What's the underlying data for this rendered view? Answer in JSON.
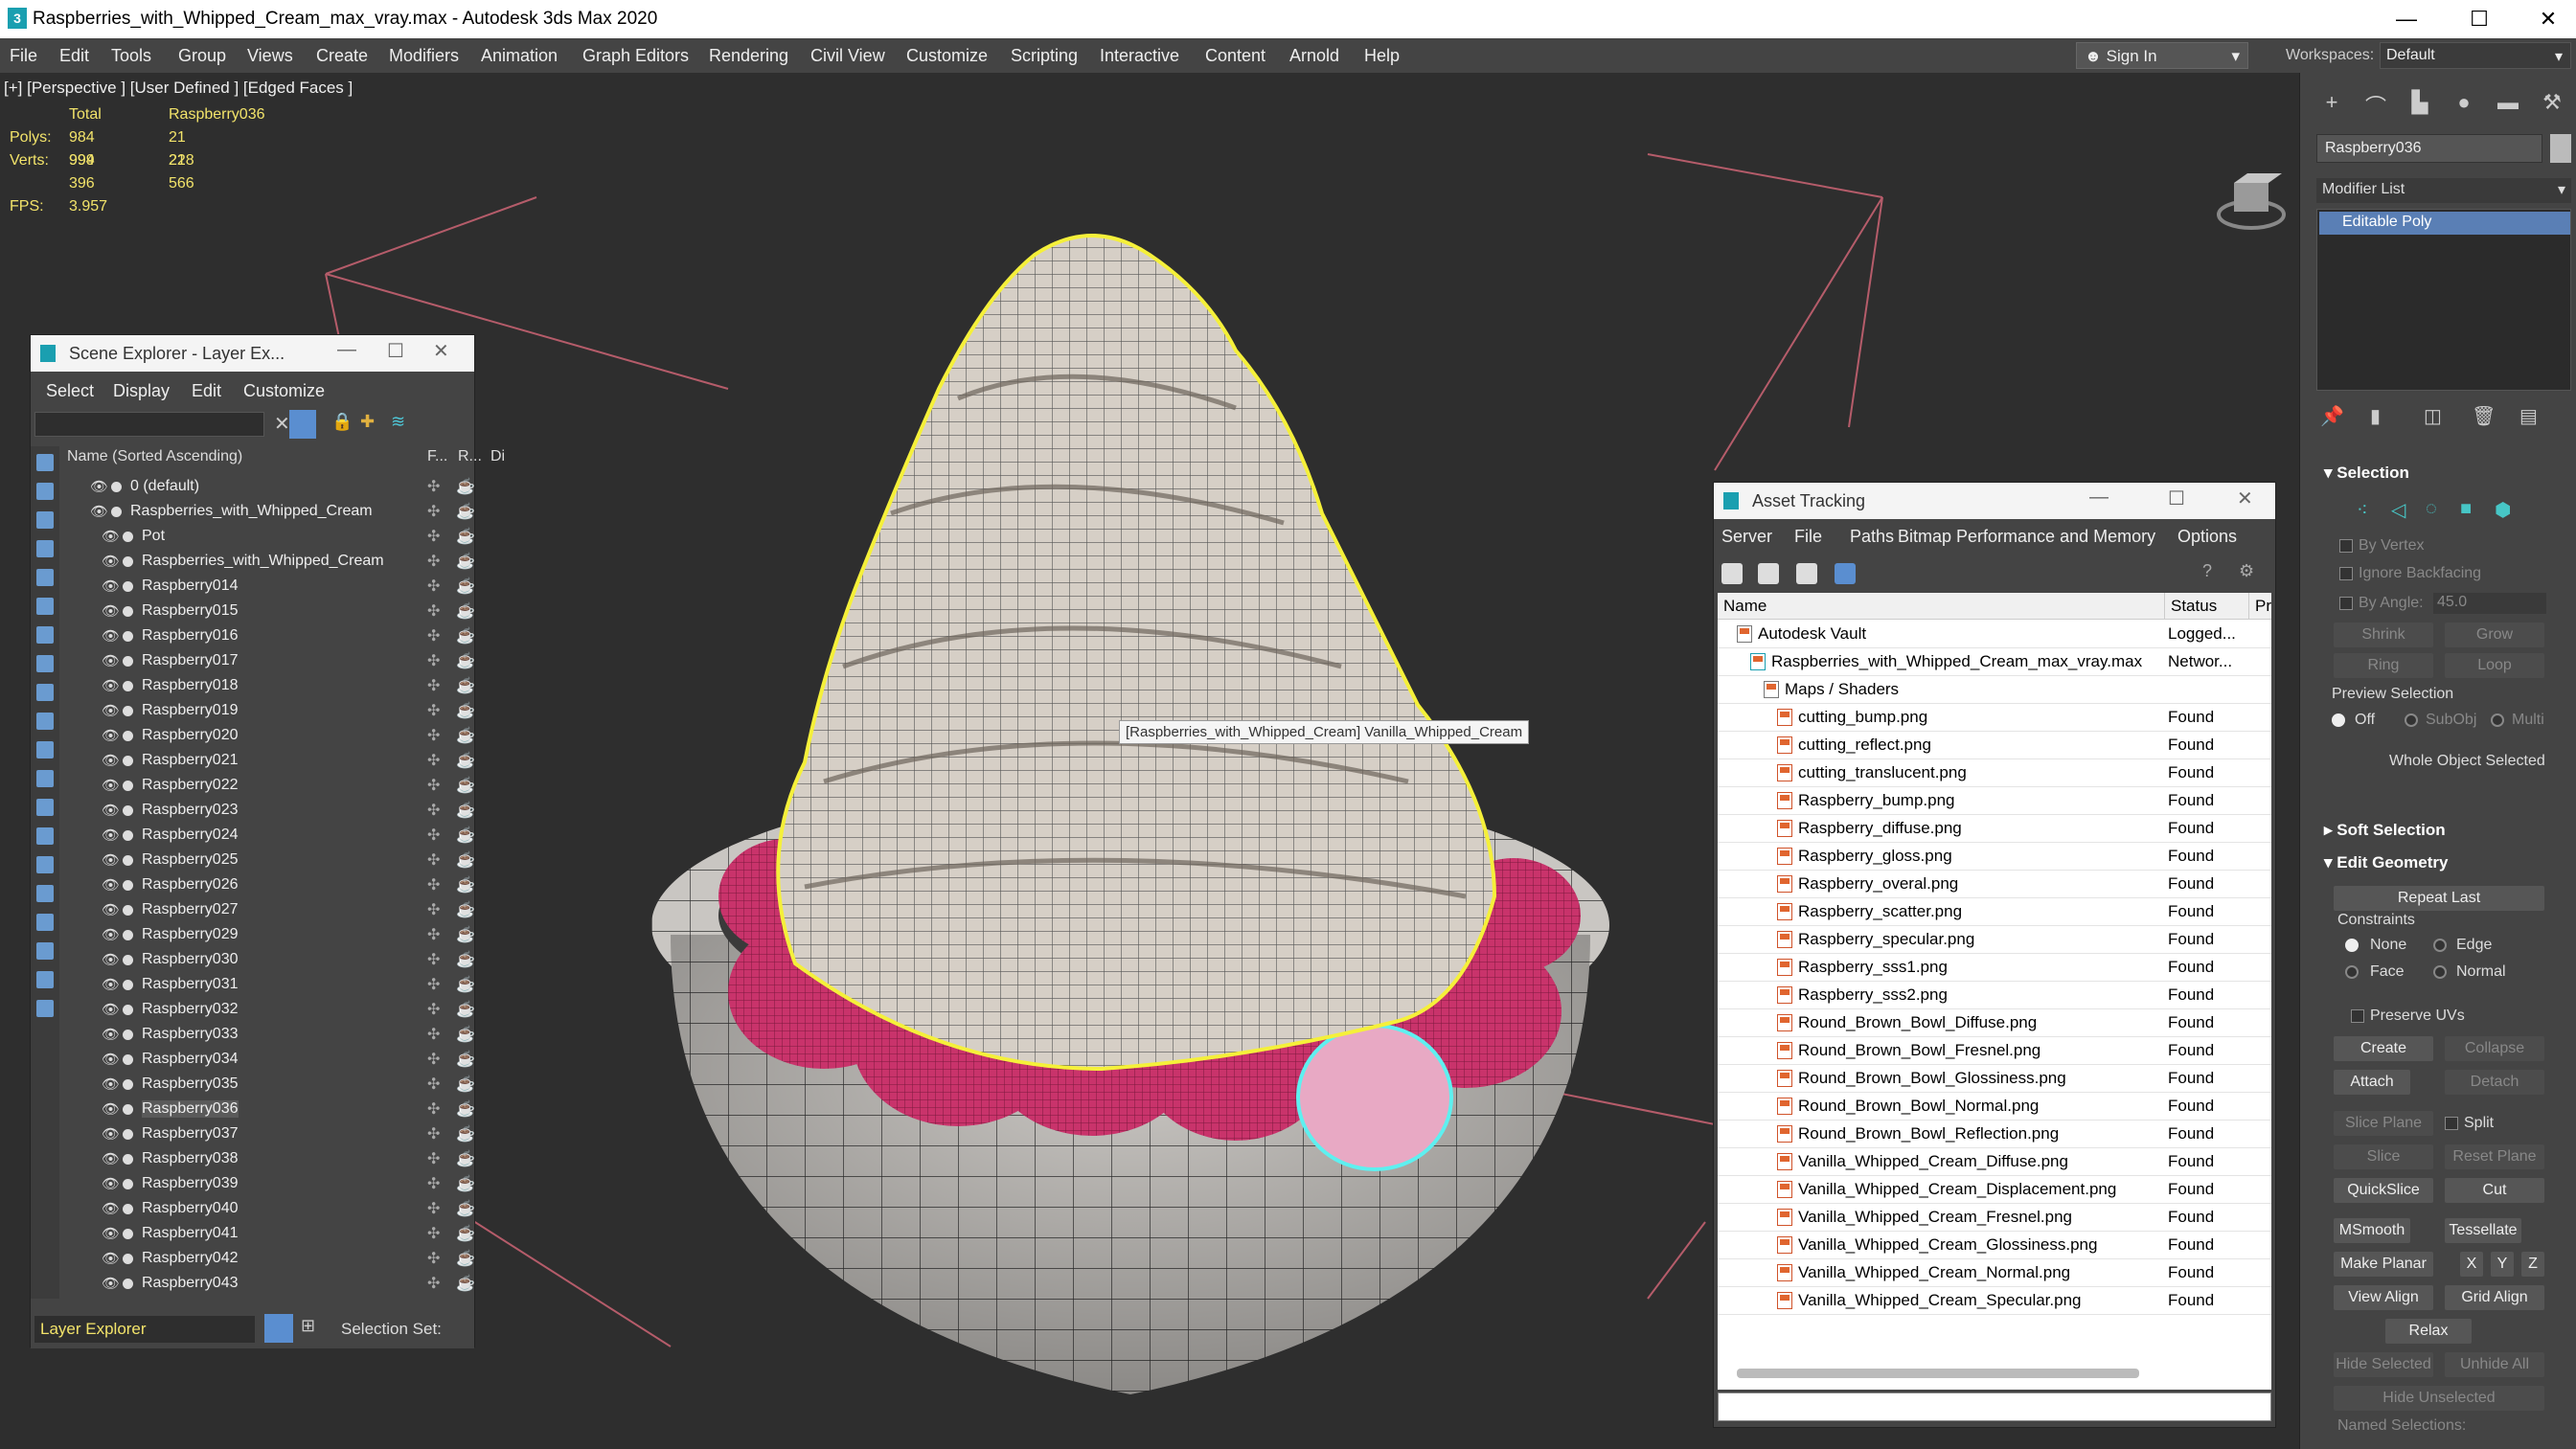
{
  "window": {
    "title": "Raspberries_with_Whipped_Cream_max_vray.max - Autodesk 3ds Max 2020",
    "minimize": "—",
    "maximize": "☐",
    "close": "✕"
  },
  "menubar": {
    "items": [
      "File",
      "Edit",
      "Tools",
      "Group",
      "Views",
      "Create",
      "Modifiers",
      "Animation",
      "Graph Editors",
      "Rendering",
      "Civil View",
      "Customize",
      "Scripting",
      "Interactive",
      "Content",
      "Arnold",
      "Help"
    ],
    "sign_in": "Sign In",
    "workspaces_label": "Workspaces:",
    "workspace_value": "Default"
  },
  "viewport": {
    "label": "[+] [Perspective ] [User Defined ] [Edged Faces ]",
    "stats": {
      "col_total": "Total",
      "col_object": "Raspberry036",
      "polys_label": "Polys:",
      "polys_total": "984 994",
      "polys_object": "21 228",
      "verts_label": "Verts:",
      "verts_total": "999 396",
      "verts_object": "21 566",
      "fps_label": "FPS:",
      "fps_value": "3.957"
    },
    "tooltip": "[Raspberries_with_Whipped_Cream] Vanilla_Whipped_Cream"
  },
  "command_panel": {
    "object_name": "Raspberry036",
    "modifier_list": "Modifier List",
    "stack_item": "Editable Poly",
    "selection": {
      "header": "Selection",
      "by_vertex": "By Vertex",
      "ignore_backfacing": "Ignore Backfacing",
      "by_angle": "By Angle:",
      "angle_value": "45.0",
      "shrink": "Shrink",
      "grow": "Grow",
      "ring": "Ring",
      "loop": "Loop",
      "preview_selection": "Preview Selection",
      "off": "Off",
      "subobj": "SubObj",
      "multi": "Multi",
      "whole_object": "Whole Object Selected"
    },
    "soft_selection": "Soft Selection",
    "edit_geometry": {
      "header": "Edit Geometry",
      "repeat_last": "Repeat Last",
      "constraints": "Constraints",
      "none": "None",
      "edge": "Edge",
      "face": "Face",
      "normal": "Normal",
      "preserve_uvs": "Preserve UVs",
      "create": "Create",
      "collapse": "Collapse",
      "attach": "Attach",
      "detach": "Detach",
      "slice_plane": "Slice Plane",
      "split": "Split",
      "slice": "Slice",
      "reset_plane": "Reset Plane",
      "quickslice": "QuickSlice",
      "cut": "Cut",
      "msmooth": "MSmooth",
      "tessellate": "Tessellate",
      "make_planar": "Make Planar",
      "x": "X",
      "y": "Y",
      "z": "Z",
      "view_align": "View Align",
      "grid_align": "Grid Align",
      "relax": "Relax",
      "hide_selected": "Hide Selected",
      "unhide_all": "Unhide All",
      "hide_unselected": "Hide Unselected",
      "named_selections": "Named Selections:"
    }
  },
  "scene_explorer": {
    "title": "Scene Explorer - Layer Ex...",
    "menu": [
      "Select",
      "Display",
      "Edit",
      "Customize"
    ],
    "col_name": "Name (Sorted Ascending)",
    "col_f": "F...",
    "col_r": "R...",
    "col_d": "Di",
    "rows": [
      {
        "name": "0 (default)",
        "level": 0
      },
      {
        "name": "Raspberries_with_Whipped_Cream",
        "level": 0
      },
      {
        "name": "Pot",
        "level": 1
      },
      {
        "name": "Raspberries_with_Whipped_Cream",
        "level": 1
      },
      {
        "name": "Raspberry014",
        "level": 1
      },
      {
        "name": "Raspberry015",
        "level": 1
      },
      {
        "name": "Raspberry016",
        "level": 1
      },
      {
        "name": "Raspberry017",
        "level": 1
      },
      {
        "name": "Raspberry018",
        "level": 1
      },
      {
        "name": "Raspberry019",
        "level": 1
      },
      {
        "name": "Raspberry020",
        "level": 1
      },
      {
        "name": "Raspberry021",
        "level": 1
      },
      {
        "name": "Raspberry022",
        "level": 1
      },
      {
        "name": "Raspberry023",
        "level": 1
      },
      {
        "name": "Raspberry024",
        "level": 1
      },
      {
        "name": "Raspberry025",
        "level": 1
      },
      {
        "name": "Raspberry026",
        "level": 1
      },
      {
        "name": "Raspberry027",
        "level": 1
      },
      {
        "name": "Raspberry029",
        "level": 1
      },
      {
        "name": "Raspberry030",
        "level": 1
      },
      {
        "name": "Raspberry031",
        "level": 1
      },
      {
        "name": "Raspberry032",
        "level": 1
      },
      {
        "name": "Raspberry033",
        "level": 1
      },
      {
        "name": "Raspberry034",
        "level": 1
      },
      {
        "name": "Raspberry035",
        "level": 1
      },
      {
        "name": "Raspberry036",
        "level": 1,
        "selected": true
      },
      {
        "name": "Raspberry037",
        "level": 1
      },
      {
        "name": "Raspberry038",
        "level": 1
      },
      {
        "name": "Raspberry039",
        "level": 1
      },
      {
        "name": "Raspberry040",
        "level": 1
      },
      {
        "name": "Raspberry041",
        "level": 1
      },
      {
        "name": "Raspberry042",
        "level": 1
      },
      {
        "name": "Raspberry043",
        "level": 1
      }
    ],
    "layer_explorer": "Layer Explorer",
    "selection_set": "Selection Set:"
  },
  "asset_tracking": {
    "title": "Asset Tracking",
    "menu": [
      "Server",
      "File",
      "Paths",
      "Bitmap Performance and Memory",
      "Options"
    ],
    "col_name": "Name",
    "col_status": "Status",
    "col_pr": "Pro",
    "rows": [
      {
        "name": "Autodesk Vault",
        "status": "Logged...",
        "level": 0,
        "kind": "vault"
      },
      {
        "name": "Raspberries_with_Whipped_Cream_max_vray.max",
        "status": "Networ...",
        "level": 1,
        "kind": "max"
      },
      {
        "name": "Maps / Shaders",
        "status": "",
        "level": 2,
        "kind": "folder"
      },
      {
        "name": "cutting_bump.png",
        "status": "Found",
        "level": 3,
        "kind": "file"
      },
      {
        "name": "cutting_reflect.png",
        "status": "Found",
        "level": 3,
        "kind": "file"
      },
      {
        "name": "cutting_translucent.png",
        "status": "Found",
        "level": 3,
        "kind": "file"
      },
      {
        "name": "Raspberry_bump.png",
        "status": "Found",
        "level": 3,
        "kind": "file"
      },
      {
        "name": "Raspberry_diffuse.png",
        "status": "Found",
        "level": 3,
        "kind": "file"
      },
      {
        "name": "Raspberry_gloss.png",
        "status": "Found",
        "level": 3,
        "kind": "file"
      },
      {
        "name": "Raspberry_overal.png",
        "status": "Found",
        "level": 3,
        "kind": "file"
      },
      {
        "name": "Raspberry_scatter.png",
        "status": "Found",
        "level": 3,
        "kind": "file"
      },
      {
        "name": "Raspberry_specular.png",
        "status": "Found",
        "level": 3,
        "kind": "file"
      },
      {
        "name": "Raspberry_sss1.png",
        "status": "Found",
        "level": 3,
        "kind": "file"
      },
      {
        "name": "Raspberry_sss2.png",
        "status": "Found",
        "level": 3,
        "kind": "file"
      },
      {
        "name": "Round_Brown_Bowl_Diffuse.png",
        "status": "Found",
        "level": 3,
        "kind": "file"
      },
      {
        "name": "Round_Brown_Bowl_Fresnel.png",
        "status": "Found",
        "level": 3,
        "kind": "file"
      },
      {
        "name": "Round_Brown_Bowl_Glossiness.png",
        "status": "Found",
        "level": 3,
        "kind": "file"
      },
      {
        "name": "Round_Brown_Bowl_Normal.png",
        "status": "Found",
        "level": 3,
        "kind": "file"
      },
      {
        "name": "Round_Brown_Bowl_Reflection.png",
        "status": "Found",
        "level": 3,
        "kind": "file"
      },
      {
        "name": "Vanilla_Whipped_Cream_Diffuse.png",
        "status": "Found",
        "level": 3,
        "kind": "file"
      },
      {
        "name": "Vanilla_Whipped_Cream_Displacement.png",
        "status": "Found",
        "level": 3,
        "kind": "file"
      },
      {
        "name": "Vanilla_Whipped_Cream_Fresnel.png",
        "status": "Found",
        "level": 3,
        "kind": "file"
      },
      {
        "name": "Vanilla_Whipped_Cream_Glossiness.png",
        "status": "Found",
        "level": 3,
        "kind": "file"
      },
      {
        "name": "Vanilla_Whipped_Cream_Normal.png",
        "status": "Found",
        "level": 3,
        "kind": "file"
      },
      {
        "name": "Vanilla_Whipped_Cream_Specular.png",
        "status": "Found",
        "level": 3,
        "kind": "file"
      }
    ]
  },
  "colors": {
    "stats_yellow": "#f2e36a",
    "selection_blue": "#5a7fb5",
    "raspberry": "#c9336b",
    "cream": "#d6cfc6",
    "bowl": "#c9c6c2"
  }
}
